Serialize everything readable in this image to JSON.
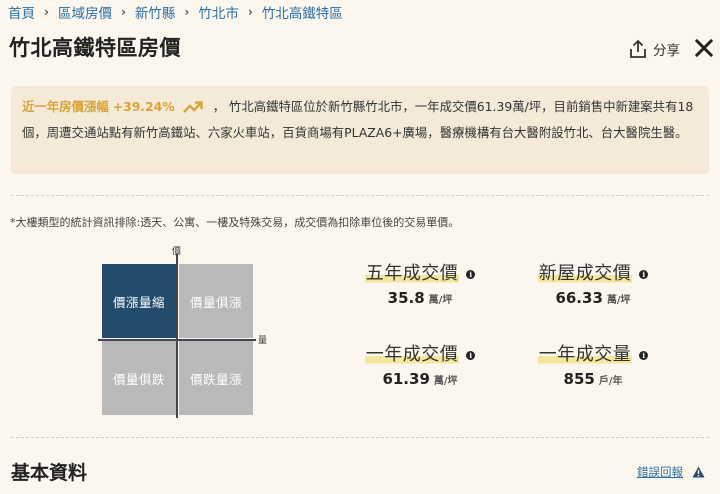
{
  "breadcrumb": [
    {
      "label": "首頁"
    },
    {
      "label": "區域房價"
    },
    {
      "label": "新竹縣"
    },
    {
      "label": "竹北市"
    },
    {
      "label": "竹北高鐵特區"
    }
  ],
  "page_title": "竹北高鐵特區房價",
  "share_label": "分享",
  "summary": {
    "growth_label": "近一年房價漲幅",
    "growth_value": "+39.24%",
    "text": "， 竹北高鐵特區位於新竹縣竹北市，一年成交價61.39萬/坪，目前銷售中新建案共有18個，周遭交通站點有新竹高鐵站、六家火車站，百貨商場有PLAZA6+廣場，醫療機構有台大醫附設竹北、台大醫院生醫。"
  },
  "note": "*大樓類型的統計資訊排除:透天、公寓、一樓及特殊交易，成交價為扣除車位後的交易單價。",
  "matrix": {
    "axis_price": "價",
    "axis_volume": "量",
    "quadrants": [
      {
        "label": "價漲量縮",
        "active": true
      },
      {
        "label": "價量俱漲",
        "active": false
      },
      {
        "label": "價量俱跌",
        "active": false
      },
      {
        "label": "價跌量漲",
        "active": false
      }
    ]
  },
  "stats": [
    {
      "title": "五年成交價",
      "value": "35.8",
      "unit": "萬/坪"
    },
    {
      "title": "新屋成交價",
      "value": "66.33",
      "unit": "萬/坪"
    },
    {
      "title": "一年成交價",
      "value": "61.39",
      "unit": "萬/坪"
    },
    {
      "title": "一年成交量",
      "value": "855",
      "unit": "戶/年"
    }
  ],
  "section_title": "基本資料",
  "report_label": "錯誤回報",
  "colors": {
    "accent": "#d9a33a",
    "link": "#2d6fa3",
    "active_quadrant": "#234b6b",
    "inactive_quadrant": "#b9b9b9",
    "highlight": "#f3e79e"
  }
}
